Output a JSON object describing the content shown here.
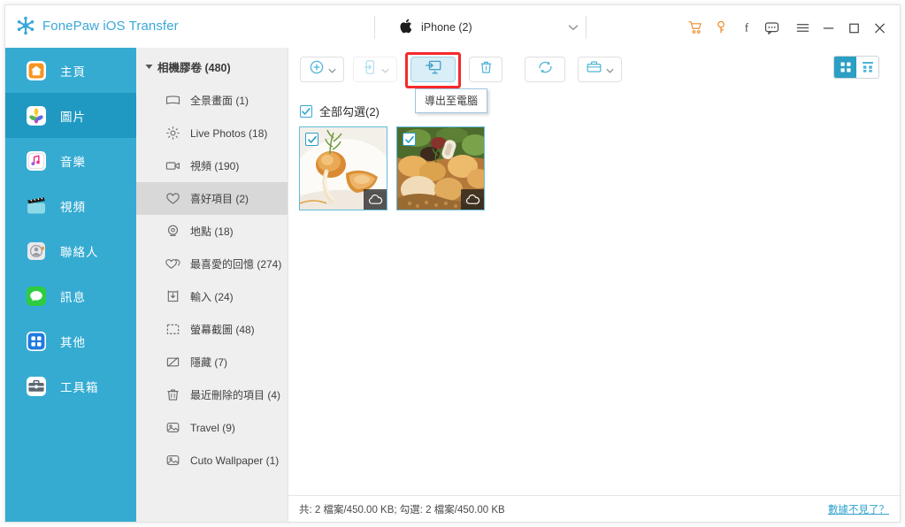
{
  "titlebar": {
    "brand": "FonePaw iOS Transfer",
    "brand_color": "#3aa8d8",
    "device": "iPhone (2)",
    "apple_glyph": "",
    "icons": [
      {
        "name": "cart-icon",
        "glyph": "⛟",
        "color": "#f08b2a"
      },
      {
        "name": "key-icon",
        "glyph": "⚷",
        "color": "#f08b2a"
      },
      {
        "name": "facebook-icon",
        "glyph": "f",
        "color": "#4a4a4a"
      },
      {
        "name": "feedback-chat-icon",
        "glyph": "▢",
        "color": "#4a4a4a"
      },
      {
        "name": "menu-icon",
        "glyph": "≡",
        "color": "#4a4a4a"
      },
      {
        "name": "minimize-icon",
        "glyph": "−",
        "color": "#4a4a4a"
      },
      {
        "name": "maximize-icon",
        "glyph": "□",
        "color": "#4a4a4a"
      },
      {
        "name": "close-icon",
        "glyph": "✕",
        "color": "#4a4a4a"
      }
    ]
  },
  "sidebar": {
    "bg": "#35abd2",
    "active_bg": "#1f99c2",
    "items": [
      {
        "label": "主頁",
        "icon": "home-icon",
        "active": false
      },
      {
        "label": "圖片",
        "icon": "photos-icon",
        "active": true
      },
      {
        "label": "音樂",
        "icon": "music-icon",
        "active": false
      },
      {
        "label": "視頻",
        "icon": "video-icon",
        "active": false
      },
      {
        "label": "聯絡人",
        "icon": "contacts-icon",
        "active": false
      },
      {
        "label": "訊息",
        "icon": "messages-icon",
        "active": false
      },
      {
        "label": "其他",
        "icon": "others-icon",
        "active": false
      },
      {
        "label": "工具箱",
        "icon": "toolbox-icon",
        "active": false
      }
    ]
  },
  "tree": {
    "header": "相機膠卷 (480)",
    "items": [
      {
        "label": "全景畫面 (1)",
        "icon": "panorama-icon",
        "selected": false
      },
      {
        "label": "Live Photos (18)",
        "icon": "live-photo-icon",
        "selected": false
      },
      {
        "label": "視頻 (190)",
        "icon": "video-camera-icon",
        "selected": false
      },
      {
        "label": "喜好項目 (2)",
        "icon": "heart-icon",
        "selected": true
      },
      {
        "label": "地點 (18)",
        "icon": "location-pin-icon",
        "selected": false
      },
      {
        "label": "最喜愛的回憶 (274)",
        "icon": "double-heart-icon",
        "selected": false
      },
      {
        "label": "輸入 (24)",
        "icon": "import-icon",
        "selected": false
      },
      {
        "label": "螢幕截圖 (48)",
        "icon": "screenshot-icon",
        "selected": false
      },
      {
        "label": "隱藏 (7)",
        "icon": "hidden-icon",
        "selected": false
      },
      {
        "label": "最近刪除的項目 (4)",
        "icon": "trash-icon",
        "selected": false
      },
      {
        "label": "Travel (9)",
        "icon": "album-icon",
        "selected": false
      },
      {
        "label": "Cuto Wallpaper (1)",
        "icon": "album-icon",
        "selected": false
      }
    ]
  },
  "toolbar": {
    "buttons": [
      {
        "name": "add-button",
        "icon": "plus-circle-icon",
        "caret": true,
        "state": "normal"
      },
      {
        "name": "export-to-device-button",
        "icon": "export-to-phone-icon",
        "caret": true,
        "state": "disabled"
      },
      {
        "name": "export-to-pc-button",
        "icon": "export-to-computer-icon",
        "caret": false,
        "state": "active"
      },
      {
        "name": "delete-button",
        "icon": "trash-icon",
        "caret": false,
        "state": "normal"
      },
      {
        "name": "refresh-button",
        "icon": "refresh-icon",
        "caret": false,
        "state": "normal"
      },
      {
        "name": "toolbox-button",
        "icon": "toolbox-icon",
        "caret": true,
        "state": "normal"
      }
    ],
    "tooltip": "導出至電腦",
    "highlight_color": "#f42b2b",
    "view_grid_large": "grid-large-icon",
    "view_grid_small": "grid-small-icon"
  },
  "content": {
    "select_all_label": "全部勾選(2)",
    "select_all_checked": true,
    "thumbnails": [
      {
        "name": "photo-thumbnail-1",
        "checked": true,
        "cloud": true,
        "alt": "plated dessert with herb garnish"
      },
      {
        "name": "photo-thumbnail-2",
        "checked": true,
        "cloud": true,
        "alt": "salad plate with chicken and vegetables"
      }
    ]
  },
  "statusbar": {
    "text": "共: 2 檔案/450.00 KB; 勾選: 2 檔案/450.00 KB",
    "link": "數據不見了？",
    "link_color": "#2fa4cf"
  }
}
